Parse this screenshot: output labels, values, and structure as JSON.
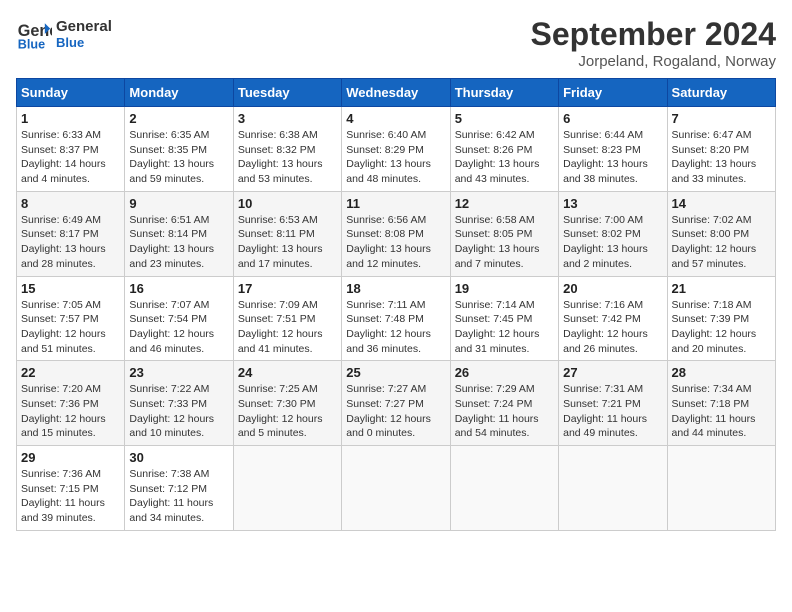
{
  "header": {
    "logo_line1": "General",
    "logo_line2": "Blue",
    "title": "September 2024",
    "subtitle": "Jorpeland, Rogaland, Norway"
  },
  "weekdays": [
    "Sunday",
    "Monday",
    "Tuesday",
    "Wednesday",
    "Thursday",
    "Friday",
    "Saturday"
  ],
  "weeks": [
    [
      {
        "day": "1",
        "info": "Sunrise: 6:33 AM\nSunset: 8:37 PM\nDaylight: 14 hours\nand 4 minutes."
      },
      {
        "day": "2",
        "info": "Sunrise: 6:35 AM\nSunset: 8:35 PM\nDaylight: 13 hours\nand 59 minutes."
      },
      {
        "day": "3",
        "info": "Sunrise: 6:38 AM\nSunset: 8:32 PM\nDaylight: 13 hours\nand 53 minutes."
      },
      {
        "day": "4",
        "info": "Sunrise: 6:40 AM\nSunset: 8:29 PM\nDaylight: 13 hours\nand 48 minutes."
      },
      {
        "day": "5",
        "info": "Sunrise: 6:42 AM\nSunset: 8:26 PM\nDaylight: 13 hours\nand 43 minutes."
      },
      {
        "day": "6",
        "info": "Sunrise: 6:44 AM\nSunset: 8:23 PM\nDaylight: 13 hours\nand 38 minutes."
      },
      {
        "day": "7",
        "info": "Sunrise: 6:47 AM\nSunset: 8:20 PM\nDaylight: 13 hours\nand 33 minutes."
      }
    ],
    [
      {
        "day": "8",
        "info": "Sunrise: 6:49 AM\nSunset: 8:17 PM\nDaylight: 13 hours\nand 28 minutes."
      },
      {
        "day": "9",
        "info": "Sunrise: 6:51 AM\nSunset: 8:14 PM\nDaylight: 13 hours\nand 23 minutes."
      },
      {
        "day": "10",
        "info": "Sunrise: 6:53 AM\nSunset: 8:11 PM\nDaylight: 13 hours\nand 17 minutes."
      },
      {
        "day": "11",
        "info": "Sunrise: 6:56 AM\nSunset: 8:08 PM\nDaylight: 13 hours\nand 12 minutes."
      },
      {
        "day": "12",
        "info": "Sunrise: 6:58 AM\nSunset: 8:05 PM\nDaylight: 13 hours\nand 7 minutes."
      },
      {
        "day": "13",
        "info": "Sunrise: 7:00 AM\nSunset: 8:02 PM\nDaylight: 13 hours\nand 2 minutes."
      },
      {
        "day": "14",
        "info": "Sunrise: 7:02 AM\nSunset: 8:00 PM\nDaylight: 12 hours\nand 57 minutes."
      }
    ],
    [
      {
        "day": "15",
        "info": "Sunrise: 7:05 AM\nSunset: 7:57 PM\nDaylight: 12 hours\nand 51 minutes."
      },
      {
        "day": "16",
        "info": "Sunrise: 7:07 AM\nSunset: 7:54 PM\nDaylight: 12 hours\nand 46 minutes."
      },
      {
        "day": "17",
        "info": "Sunrise: 7:09 AM\nSunset: 7:51 PM\nDaylight: 12 hours\nand 41 minutes."
      },
      {
        "day": "18",
        "info": "Sunrise: 7:11 AM\nSunset: 7:48 PM\nDaylight: 12 hours\nand 36 minutes."
      },
      {
        "day": "19",
        "info": "Sunrise: 7:14 AM\nSunset: 7:45 PM\nDaylight: 12 hours\nand 31 minutes."
      },
      {
        "day": "20",
        "info": "Sunrise: 7:16 AM\nSunset: 7:42 PM\nDaylight: 12 hours\nand 26 minutes."
      },
      {
        "day": "21",
        "info": "Sunrise: 7:18 AM\nSunset: 7:39 PM\nDaylight: 12 hours\nand 20 minutes."
      }
    ],
    [
      {
        "day": "22",
        "info": "Sunrise: 7:20 AM\nSunset: 7:36 PM\nDaylight: 12 hours\nand 15 minutes."
      },
      {
        "day": "23",
        "info": "Sunrise: 7:22 AM\nSunset: 7:33 PM\nDaylight: 12 hours\nand 10 minutes."
      },
      {
        "day": "24",
        "info": "Sunrise: 7:25 AM\nSunset: 7:30 PM\nDaylight: 12 hours\nand 5 minutes."
      },
      {
        "day": "25",
        "info": "Sunrise: 7:27 AM\nSunset: 7:27 PM\nDaylight: 12 hours\nand 0 minutes."
      },
      {
        "day": "26",
        "info": "Sunrise: 7:29 AM\nSunset: 7:24 PM\nDaylight: 11 hours\nand 54 minutes."
      },
      {
        "day": "27",
        "info": "Sunrise: 7:31 AM\nSunset: 7:21 PM\nDaylight: 11 hours\nand 49 minutes."
      },
      {
        "day": "28",
        "info": "Sunrise: 7:34 AM\nSunset: 7:18 PM\nDaylight: 11 hours\nand 44 minutes."
      }
    ],
    [
      {
        "day": "29",
        "info": "Sunrise: 7:36 AM\nSunset: 7:15 PM\nDaylight: 11 hours\nand 39 minutes."
      },
      {
        "day": "30",
        "info": "Sunrise: 7:38 AM\nSunset: 7:12 PM\nDaylight: 11 hours\nand 34 minutes."
      },
      {
        "day": "",
        "info": ""
      },
      {
        "day": "",
        "info": ""
      },
      {
        "day": "",
        "info": ""
      },
      {
        "day": "",
        "info": ""
      },
      {
        "day": "",
        "info": ""
      }
    ]
  ]
}
